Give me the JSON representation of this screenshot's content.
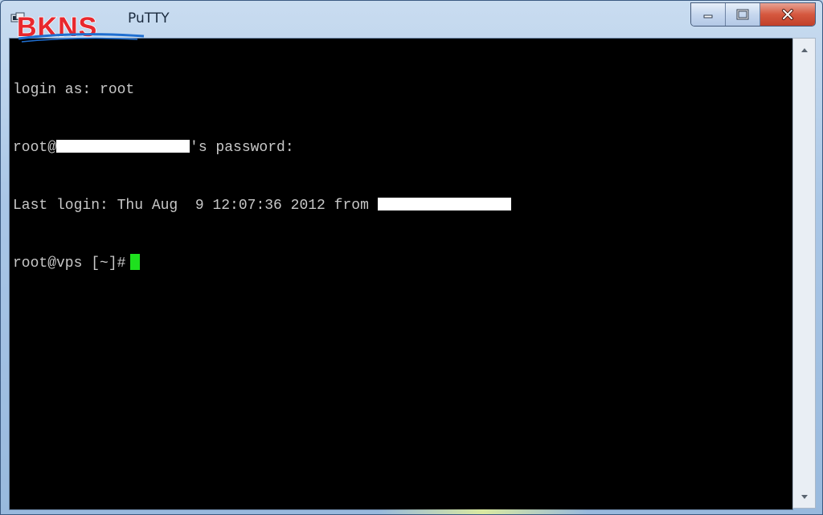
{
  "window": {
    "title": "PuTTY",
    "controls": {
      "minimize_icon": "minimize-icon",
      "maximize_icon": "maximize-icon",
      "close_icon": "close-icon"
    }
  },
  "logo": {
    "text": "BKNS",
    "colors": {
      "primary": "#e8282e",
      "accent": "#1f6fd1"
    }
  },
  "terminal": {
    "lines": [
      {
        "text": "login as: root"
      },
      {
        "prefix": "root@",
        "suffix": "'s password:"
      },
      {
        "prefix": "Last login: Thu Aug  9 12:07:36 2012 from "
      },
      {
        "text": "root@vps [~]#"
      }
    ],
    "colors": {
      "background": "#000000",
      "foreground": "#c8c8c8",
      "cursor": "#1ee01e",
      "redaction": "#ffffff"
    }
  },
  "scrollbar": {
    "up_icon": "scroll-up-arrow-icon",
    "down_icon": "scroll-down-arrow-icon"
  }
}
